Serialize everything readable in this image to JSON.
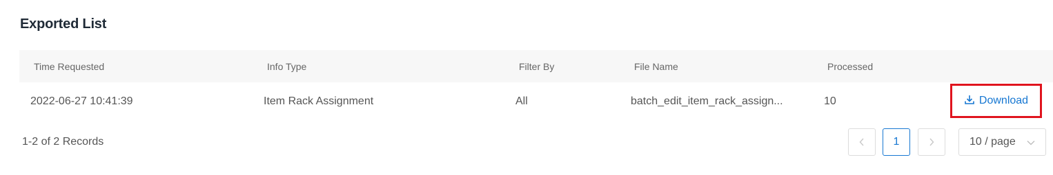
{
  "title": "Exported List",
  "table": {
    "headers": {
      "time": "Time Requested",
      "info": "Info Type",
      "filter": "Filter By",
      "file": "File Name",
      "processed": "Processed"
    },
    "rows": [
      {
        "time": "2022-06-27 10:41:39",
        "info": "Item Rack Assignment",
        "filter": "All",
        "file": "batch_edit_item_rack_assign...",
        "processed": "10",
        "action": "Download"
      }
    ]
  },
  "footer": {
    "records": "1-2 of 2 Records",
    "pagination": {
      "prev": "<",
      "current": "1",
      "next": ">",
      "page_size": "10 / page"
    }
  },
  "colors": {
    "accent": "#1677d2",
    "highlight": "#e0141e"
  }
}
